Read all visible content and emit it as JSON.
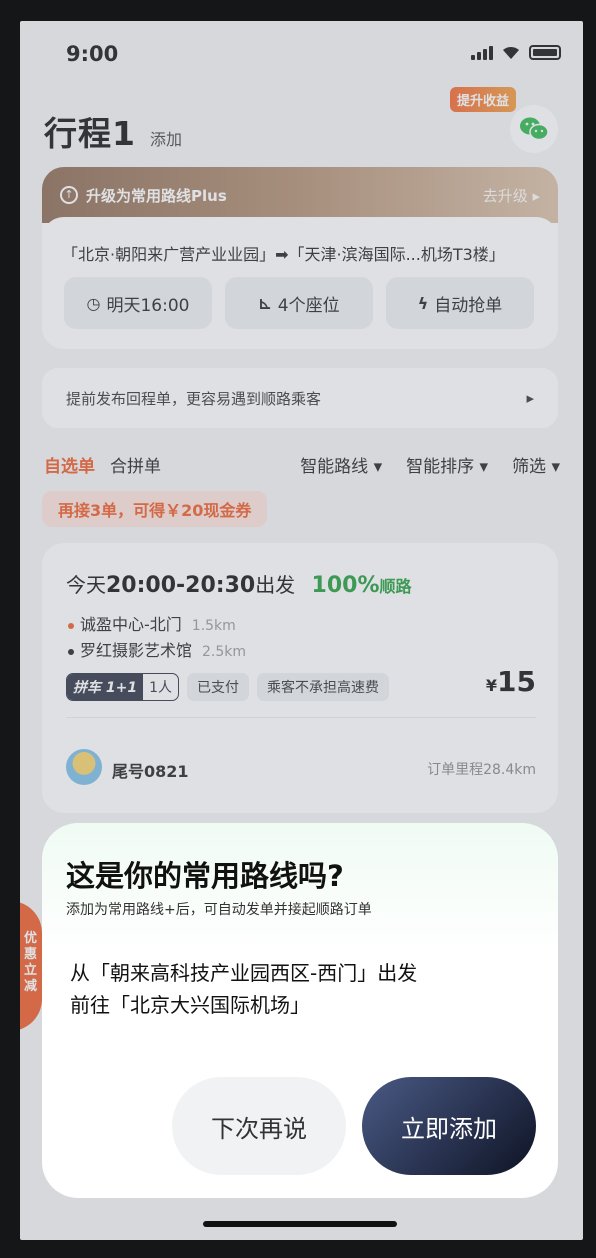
{
  "status_bar": {
    "time": "9:00"
  },
  "header": {
    "title": "行程1",
    "add_label": "添加",
    "promo_badge": "提升收益"
  },
  "route_card": {
    "upgrade_label": "升级为常用路线Plus",
    "upgrade_action": "去升级 ▸",
    "route": "「北京·朝阳来广营产业业园」➡「天津·滨海国际...机场T3楼」",
    "chips": [
      {
        "icon": "clock-icon",
        "glyph": "◷",
        "label": "明天16:00"
      },
      {
        "icon": "seat-icon",
        "glyph": "⊾",
        "label": "4个座位"
      },
      {
        "icon": "bolt-icon",
        "glyph": "ϟ",
        "label": "自动抢单"
      }
    ]
  },
  "return_tip": {
    "text": "提前发布回程单，更容易遇到顺路乘客",
    "arrow": "▸"
  },
  "filter_bar": {
    "tab_active": "自选单",
    "tab_other": "合拼单",
    "filters": [
      "智能路线 ▾",
      "智能排序 ▾",
      "筛选 ▾"
    ]
  },
  "coupon": {
    "text": "再接3单，可得￥20现金券"
  },
  "order": {
    "time_prefix": "今天",
    "time_range": "20:00-20:30",
    "time_suffix": "出发",
    "match_value": "100%",
    "match_label": "顺路",
    "start": {
      "name": "诚盈中心-北门",
      "distance": "1.5km",
      "color": "#f05a28"
    },
    "end": {
      "name": "罗红摄影艺术馆",
      "distance": "2.5km",
      "color": "#222222"
    },
    "pool_tag_a": "拼车 1+1",
    "pool_tag_b": "1人",
    "tags": [
      "已支付",
      "乘客不承担高速费"
    ],
    "price_currency": "¥",
    "price": "15",
    "tail_number": "尾号0821",
    "mileage": "订单里程28.4km"
  },
  "side_tab": {
    "text": "优惠立减"
  },
  "dialog": {
    "title": "这是你的常用路线吗?",
    "subtitle": "添加为常用路线+后，可自动发单并接起顺路订单",
    "route_line1": "从「朝来高科技产业园西区-西门」出发",
    "route_line2": "前往「北京大兴国际机场」",
    "later_button": "下次再说",
    "add_button": "立即添加"
  },
  "colors": {
    "accent": "#f05a28",
    "match": "#1f9d3a",
    "primary_dark": "#1c2238"
  }
}
